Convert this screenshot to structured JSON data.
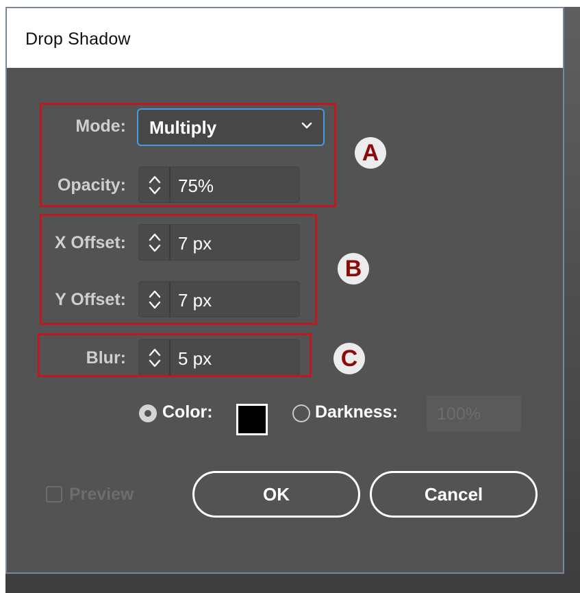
{
  "dialog": {
    "title": "Drop Shadow"
  },
  "mode": {
    "label": "Mode:",
    "value": "Multiply",
    "icon": "chevron-down-icon"
  },
  "opacity": {
    "label": "Opacity:",
    "value": "75%"
  },
  "x_offset": {
    "label": "X Offset:",
    "value": "7 px"
  },
  "y_offset": {
    "label": "Y Offset:",
    "value": "7 px"
  },
  "blur": {
    "label": "Blur:",
    "value": "5 px"
  },
  "color_option": {
    "label": "Color:",
    "selected": true,
    "swatch_color": "#000000"
  },
  "darkness_option": {
    "label": "Darkness:",
    "selected": false,
    "value": "100%"
  },
  "preview": {
    "label": "Preview",
    "checked": false,
    "enabled": false
  },
  "buttons": {
    "ok": "OK",
    "cancel": "Cancel"
  },
  "annotations": {
    "a": "A",
    "b": "B",
    "c": "C",
    "box_color": "#c2171d",
    "marker_text_color": "#8b0a0a"
  }
}
